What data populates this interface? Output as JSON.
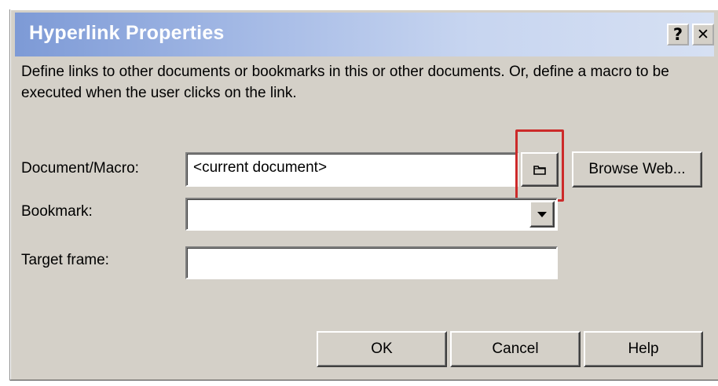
{
  "dialog": {
    "title": "Hyperlink Properties",
    "help_button": "?",
    "close_button": "✕",
    "description": "Define links to other documents or bookmarks in this or other documents. Or, define a macro to be executed when the user clicks on the link."
  },
  "form": {
    "document_label": "Document/Macro:",
    "document_value": "<current document>",
    "browse_file_icon": "folder-icon",
    "browse_web_label": "Browse Web...",
    "bookmark_label": "Bookmark:",
    "bookmark_value": "",
    "target_frame_label": "Target frame:",
    "target_frame_value": ""
  },
  "buttons": {
    "ok": "OK",
    "cancel": "Cancel",
    "help": "Help"
  },
  "colors": {
    "title_gradient_start": "#7d9ad6",
    "dialog_face": "#d4d0c8",
    "highlight": "#cc2a2a"
  }
}
